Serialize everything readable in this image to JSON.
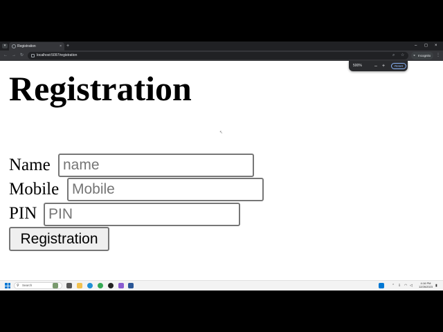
{
  "browser": {
    "tab_title": "Registration",
    "tab_close": "×",
    "new_tab": "+",
    "menu_glyph": "▾",
    "url": "localhost:5097/registration",
    "incognito_label": "Incognito",
    "window_controls": [
      "–",
      "◻",
      "×"
    ],
    "nav_glyphs": [
      "←",
      "→",
      "↻"
    ]
  },
  "zoom_popup": {
    "level": "500%",
    "decrease": "–",
    "increase": "+",
    "reset_label": "Reset"
  },
  "page": {
    "title": "Registration",
    "fields": [
      {
        "label": "Name",
        "placeholder": "name",
        "value": ""
      },
      {
        "label": "Mobile",
        "placeholder": "Mobile",
        "value": ""
      },
      {
        "label": "PIN",
        "placeholder": "PIN",
        "value": ""
      }
    ],
    "submit_label": "Registration"
  },
  "taskbar": {
    "search_placeholder": "Search",
    "time": "4:16 PM",
    "date": "12/26/2023"
  },
  "colors": {
    "chrome_dark": "#202124",
    "toolbar": "#35363a",
    "accent": "#8ab4f8",
    "windows_blue": "#0078d4"
  }
}
